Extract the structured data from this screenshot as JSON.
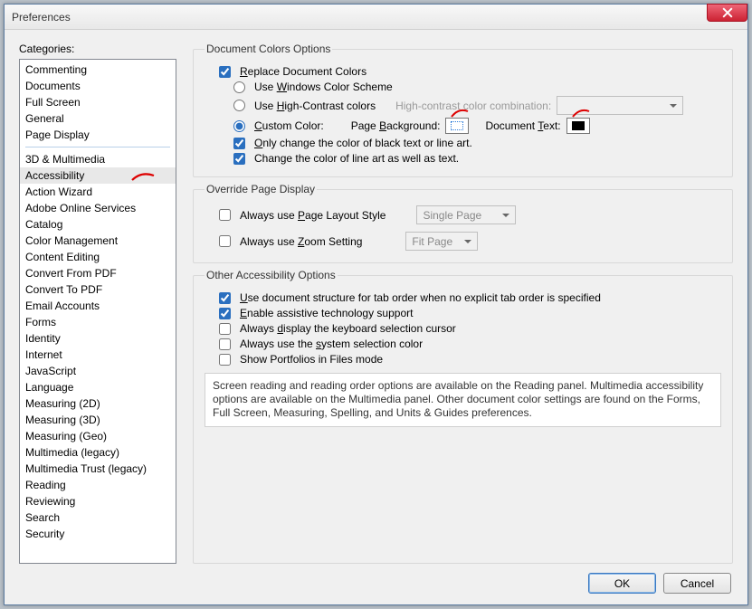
{
  "window": {
    "title": "Preferences"
  },
  "categories_label": "Categories:",
  "categories_top": [
    "Commenting",
    "Documents",
    "Full Screen",
    "General",
    "Page Display"
  ],
  "categories_rest": [
    "3D & Multimedia",
    "Accessibility",
    "Action Wizard",
    "Adobe Online Services",
    "Catalog",
    "Color Management",
    "Content Editing",
    "Convert From PDF",
    "Convert To PDF",
    "Email Accounts",
    "Forms",
    "Identity",
    "Internet",
    "JavaScript",
    "Language",
    "Measuring (2D)",
    "Measuring (3D)",
    "Measuring (Geo)",
    "Multimedia (legacy)",
    "Multimedia Trust (legacy)",
    "Reading",
    "Reviewing",
    "Search",
    "Security"
  ],
  "selected_category": "Accessibility",
  "doc_colors": {
    "legend": "Document Colors Options",
    "replace": "Replace Document Colors",
    "use_windows": "Use Windows Color Scheme",
    "use_high_contrast": "Use High-Contrast colors",
    "high_contrast_combo_label": "High-contrast color combination:",
    "custom_color": "Custom Color:",
    "page_bg": "Page Background:",
    "doc_text": "Document Text:",
    "only_black": "Only change the color of black text or line art.",
    "change_lineart": "Change the color of line art as well as text."
  },
  "override": {
    "legend": "Override Page Display",
    "layout": "Always use Page Layout Style",
    "layout_value": "Single Page",
    "zoom": "Always use Zoom Setting",
    "zoom_value": "Fit Page"
  },
  "other": {
    "legend": "Other Accessibility Options",
    "tab_order": "Use document structure for tab order when no explicit tab order is specified",
    "assistive": "Enable assistive technology support",
    "kb_cursor": "Always display the keyboard selection cursor",
    "sys_sel": "Always use the system selection color",
    "portfolios": "Show Portfolios in Files mode",
    "info": "Screen reading and reading order options are available on the Reading panel. Multimedia accessibility options are available on the Multimedia panel. Other document color settings are found on the Forms, Full Screen, Measuring, Spelling, and Units & Guides preferences."
  },
  "buttons": {
    "ok": "OK",
    "cancel": "Cancel"
  }
}
